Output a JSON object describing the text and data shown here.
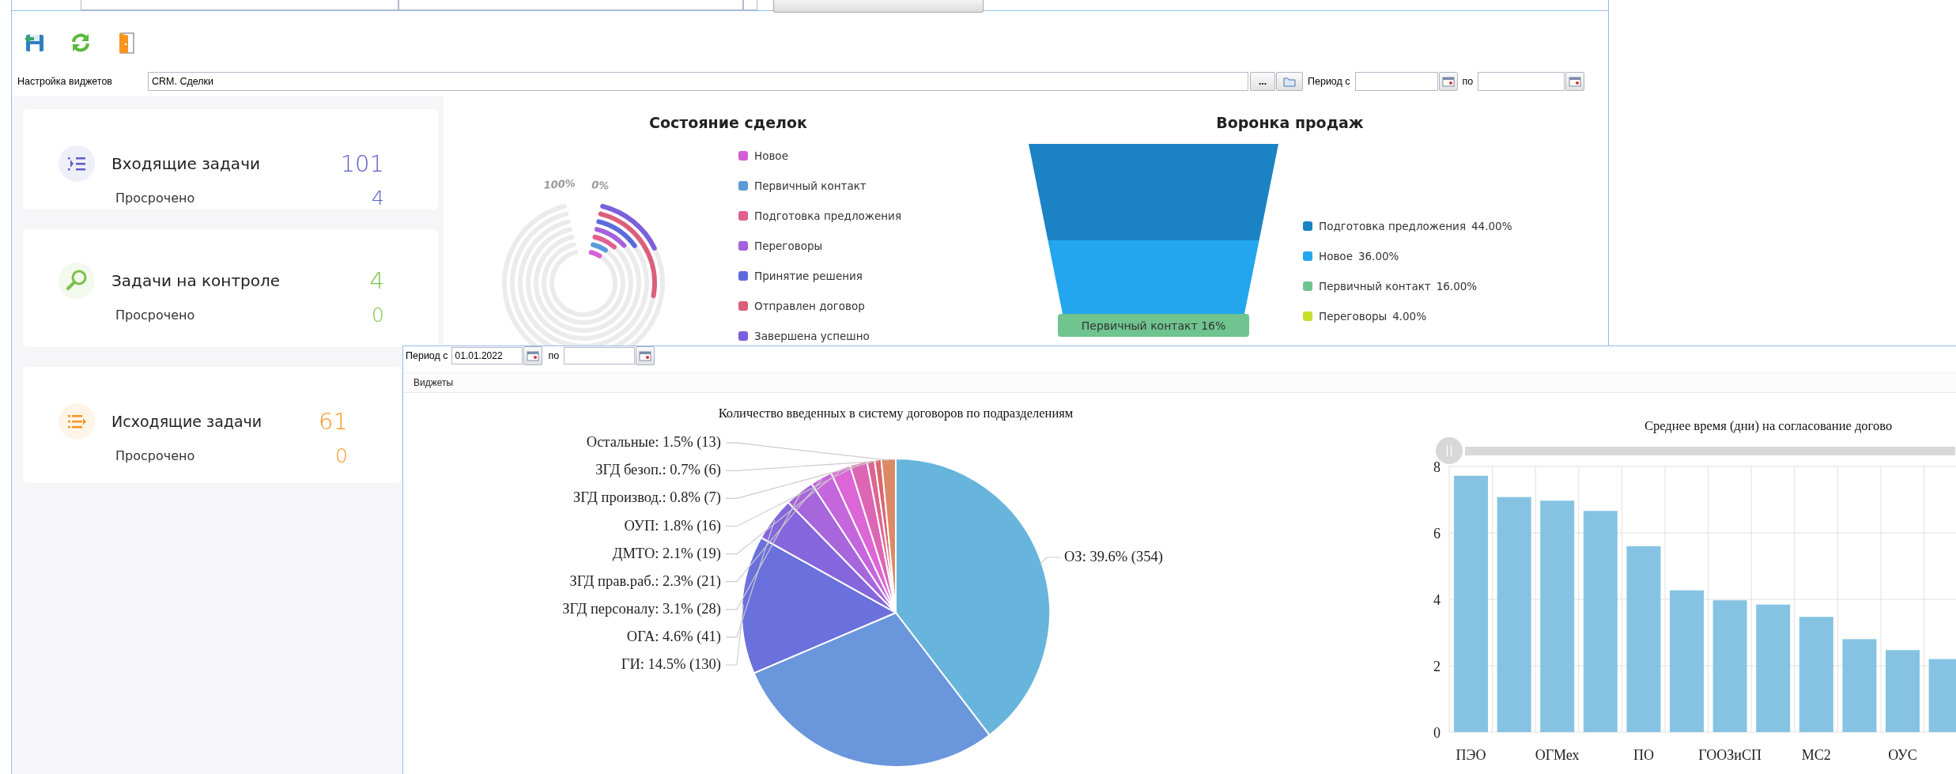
{
  "settings": {
    "label": "Настройка виджетов",
    "value": "CRM. Сделки",
    "browse_button": "...",
    "period_from_label": "Период с",
    "period_to_label": "по"
  },
  "cards": [
    {
      "kind": "incoming",
      "title": "Входящие задачи",
      "count": "101",
      "overdue_label": "Просрочено",
      "overdue_count": "4",
      "color": "#5a5fc8"
    },
    {
      "kind": "control",
      "title": "Задачи на контроле",
      "count": "4",
      "overdue_label": "Просрочено",
      "overdue_count": "0",
      "color": "#7dc24b"
    },
    {
      "kind": "outgoing",
      "title": "Исходящие задачи",
      "count": "61",
      "overdue_label": "Просрочено",
      "overdue_count": "0",
      "color": "#f7941d"
    }
  ],
  "deal_status": {
    "title": "Состояние сделок",
    "scale_labels": [
      "100%",
      "0%"
    ],
    "items": [
      {
        "label": "Новое",
        "color": "#d55fd6"
      },
      {
        "label": "Первичный контакт",
        "color": "#5b9bd9"
      },
      {
        "label": "Подготовка предложения",
        "color": "#e0608e"
      },
      {
        "label": "Переговоры",
        "color": "#a562dc"
      },
      {
        "label": "Принятие решения",
        "color": "#5b6bdc"
      },
      {
        "label": "Отправлен договор",
        "color": "#dc5f7a"
      },
      {
        "label": "Завершена успешно",
        "color": "#7b5fdc"
      }
    ]
  },
  "sales_funnel": {
    "title": "Воронка продаж",
    "segments": [
      {
        "color": "#1b82c4"
      },
      {
        "color": "#23a6ee"
      },
      {
        "color": "#6fc48f",
        "label": "Первичный контакт 16%"
      }
    ],
    "legend": [
      {
        "label": "Подготовка предложения",
        "value": "44.00%",
        "color": "#1b82c4"
      },
      {
        "label": "Новое",
        "value": "36.00%",
        "color": "#23a6ee"
      },
      {
        "label": "Первичный контакт",
        "value": "16.00%",
        "color": "#6fc48f"
      },
      {
        "label": "Переговоры",
        "value": "4.00%",
        "color": "#c6e02a"
      }
    ]
  },
  "widget_window": {
    "period_from_label": "Период с",
    "period_from": "01.01.2022",
    "period_to_label": "по",
    "section_title": "Виджеты",
    "pie_chart": {
      "chart_data": {
        "type": "pie",
        "title": "Количество введенных в систему договоров по подразделениям",
        "categories": [
          "ОЗ: 39.6% (354)",
          null,
          "ГИ: 14.5% (130)",
          "ОГА: 4.6% (41)",
          "ЗГД персоналу: 3.1% (28)",
          "ЗГД прав.раб.: 2.3% (21)",
          "ДМТО: 2.1% (19)",
          "ОУП: 1.8% (16)",
          "ЗГД производ.: 0.8% (7)",
          "ЗГД безоп.: 0.7% (6)",
          "Остальные: 1.5% (13)"
        ],
        "values": [
          39.6,
          29.0,
          14.5,
          4.6,
          3.1,
          2.3,
          2.1,
          1.8,
          0.8,
          0.7,
          1.5
        ]
      }
    },
    "bar_chart": {
      "chart_data": {
        "type": "bar",
        "title": "Среднее время (дни) на согласование догово",
        "categories": [
          "ПЭО",
          null,
          "ОГМех",
          null,
          "ПО",
          null,
          "ГООЗиСП",
          null,
          "МС2",
          null,
          "ОУС",
          null
        ],
        "values": [
          7.72,
          7.08,
          6.97,
          6.66,
          5.6,
          4.27,
          3.97,
          3.84,
          3.47,
          2.8,
          2.47,
          2.2
        ],
        "ylim": [
          0,
          8
        ],
        "yticks": [
          0,
          2,
          4,
          6,
          8
        ],
        "grid": true
      }
    }
  }
}
